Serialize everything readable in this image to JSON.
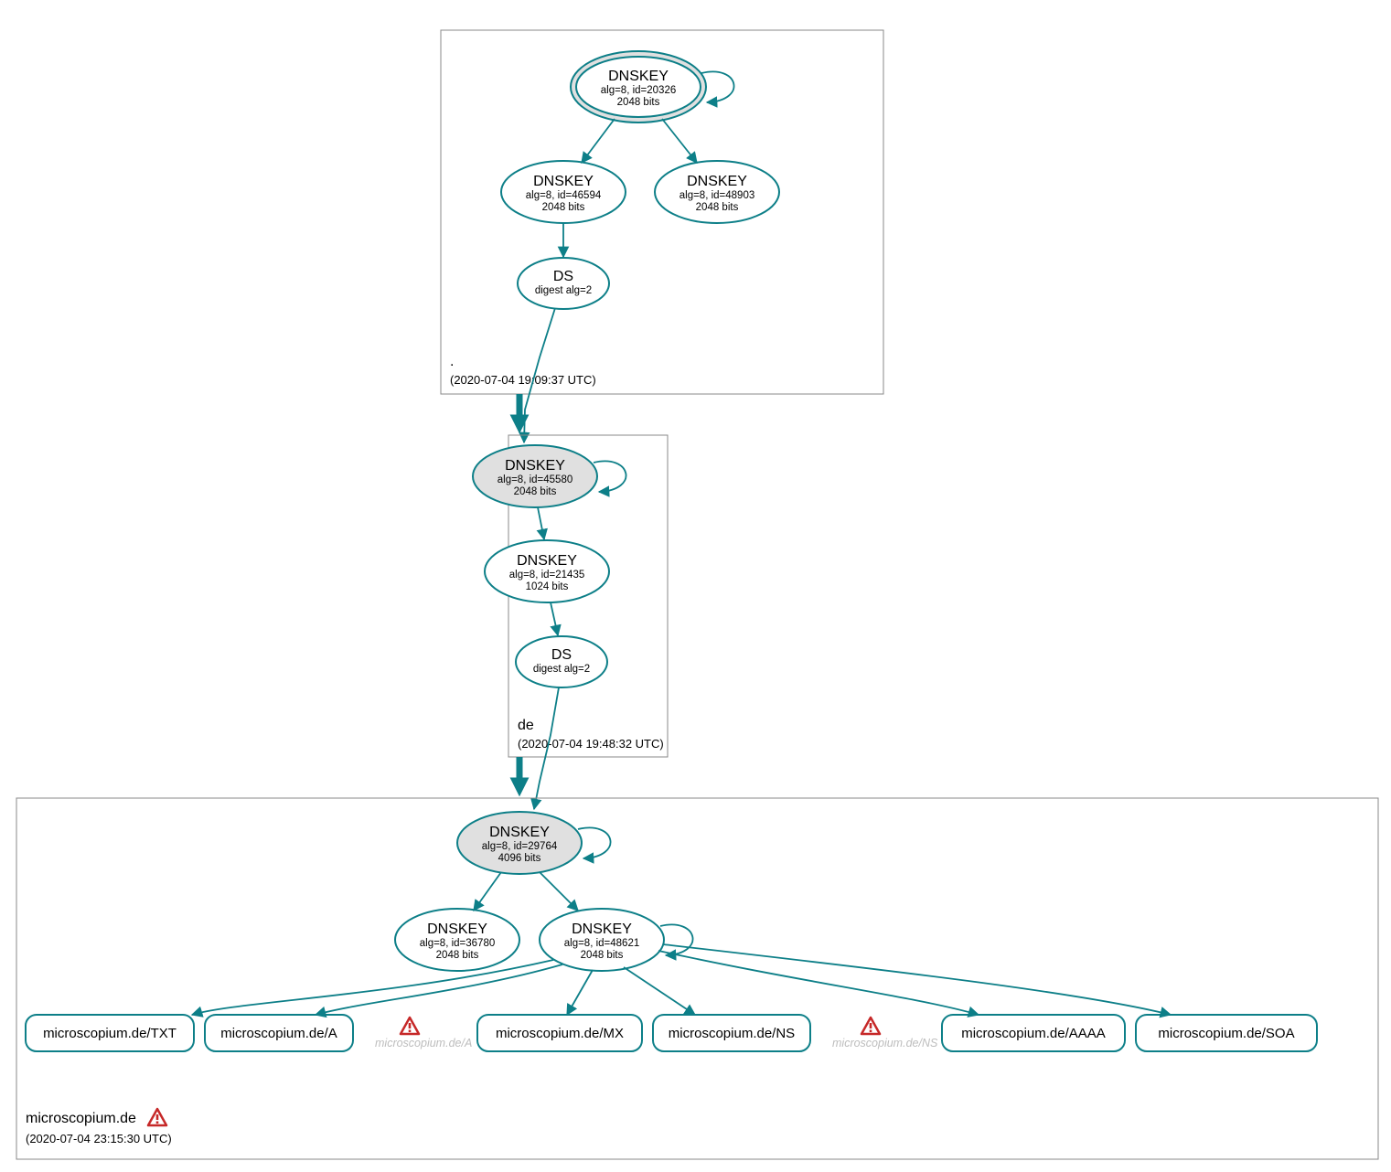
{
  "zones": {
    "root": {
      "name": ".",
      "timestamp": "(2020-07-04 19:09:37 UTC)",
      "ksk": {
        "title": "DNSKEY",
        "line1": "alg=8, id=20326",
        "line2": "2048 bits"
      },
      "zsk1": {
        "title": "DNSKEY",
        "line1": "alg=8, id=46594",
        "line2": "2048 bits"
      },
      "zsk2": {
        "title": "DNSKEY",
        "line1": "alg=8, id=48903",
        "line2": "2048 bits"
      },
      "ds": {
        "title": "DS",
        "line1": "digest alg=2"
      }
    },
    "de": {
      "name": "de",
      "timestamp": "(2020-07-04 19:48:32 UTC)",
      "ksk": {
        "title": "DNSKEY",
        "line1": "alg=8, id=45580",
        "line2": "2048 bits"
      },
      "zsk": {
        "title": "DNSKEY",
        "line1": "alg=8, id=21435",
        "line2": "1024 bits"
      },
      "ds": {
        "title": "DS",
        "line1": "digest alg=2"
      }
    },
    "domain": {
      "name": "microscopium.de",
      "timestamp": "(2020-07-04 23:15:30 UTC)",
      "ksk": {
        "title": "DNSKEY",
        "line1": "alg=8, id=29764",
        "line2": "4096 bits"
      },
      "zsk1": {
        "title": "DNSKEY",
        "line1": "alg=8, id=36780",
        "line2": "2048 bits"
      },
      "zsk2": {
        "title": "DNSKEY",
        "line1": "alg=8, id=48621",
        "line2": "2048 bits"
      },
      "rr": {
        "txt": "microscopium.de/TXT",
        "a": "microscopium.de/A",
        "mx": "microscopium.de/MX",
        "ns": "microscopium.de/NS",
        "aaaa": "microscopium.de/AAAA",
        "soa": "microscopium.de/SOA"
      },
      "warn": {
        "a": "microscopium.de/A",
        "ns": "microscopium.de/NS"
      }
    }
  }
}
